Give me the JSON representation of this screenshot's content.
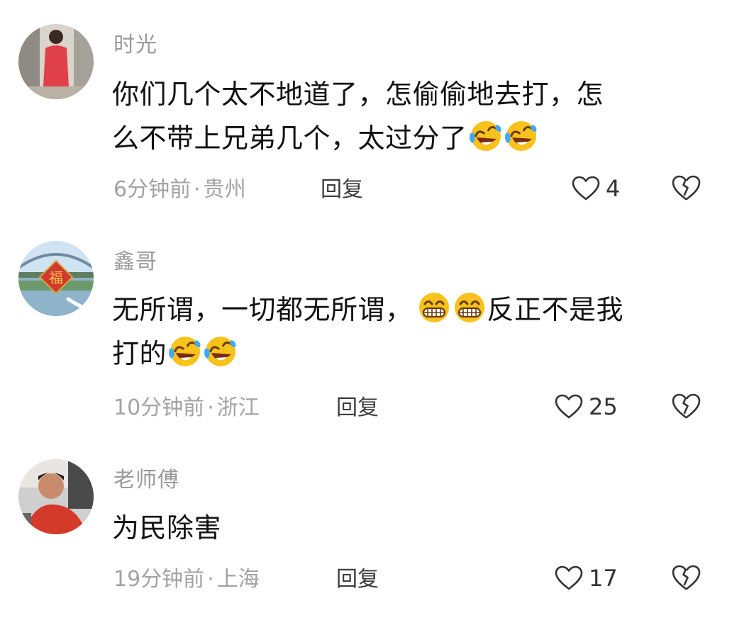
{
  "comments": [
    {
      "username": "时光",
      "text_lines": [
        "你们几个太不地道了，怎偷偷地去打，怎",
        "么不带上兄弟几个，太过分了"
      ],
      "trailing_emojis": [
        "laugh-cry-emoji",
        "laugh-cry-emoji"
      ],
      "time": "6分钟前",
      "location": "贵州",
      "reply_label": "回复",
      "likes": "4"
    },
    {
      "username": "鑫哥",
      "text_part1": "无所谓，一切都无所谓，",
      "middle_emojis": [
        "grin-emoji",
        "grin-emoji"
      ],
      "text_part2": "反正不是我",
      "text_line2": "打的",
      "trailing_emojis": [
        "laugh-cry-emoji",
        "laugh-cry-emoji"
      ],
      "time": "10分钟前",
      "location": "浙江",
      "reply_label": "回复",
      "likes": "25"
    },
    {
      "username": "老师傅",
      "text": "为民除害",
      "time": "19分钟前",
      "location": "上海",
      "reply_label": "回复",
      "likes": "17"
    }
  ],
  "separator": "·",
  "icons": {
    "like": "heart-outline-icon",
    "dislike": "broken-heart-icon"
  },
  "colors": {
    "meta_gray": "#a3a3a3",
    "username_gray": "#9a9a9a",
    "text": "#111111",
    "emoji_yellow": "#f7c21b"
  }
}
